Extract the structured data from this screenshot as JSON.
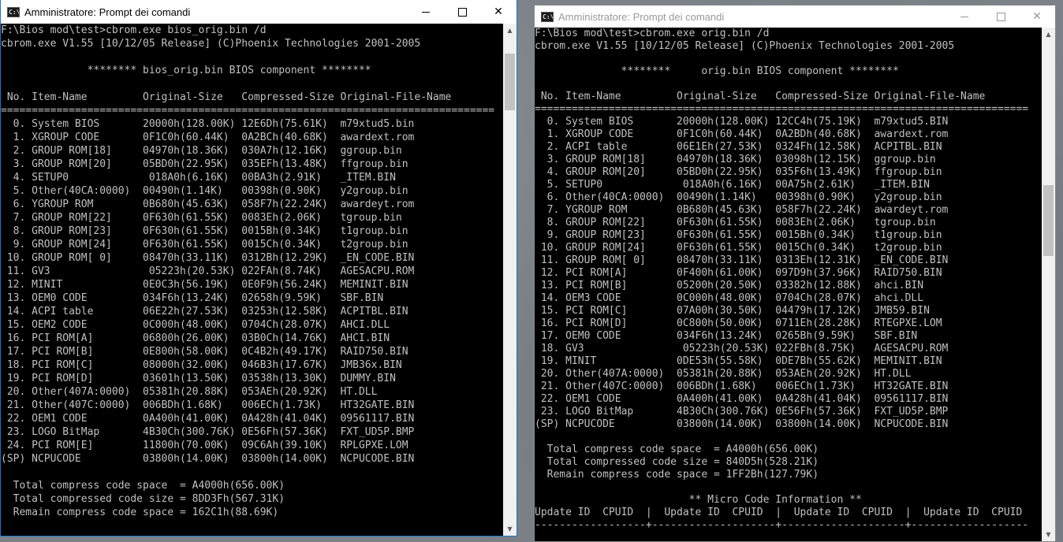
{
  "left_window": {
    "title": "Amministratore: Prompt dei comandi",
    "icon_text": "C:\\",
    "controls": {
      "minimize": "minimize",
      "maximize": "maximize",
      "close": "✕"
    },
    "lines": [
      "F:\\Bios mod\\test>cbrom.exe bios_orig.bin /d",
      "cbrom.exe V1.55 [10/12/05 Release] (C)Phoenix Technologies 2001-2005",
      "",
      "              ******** bios_orig.bin BIOS component ********",
      "",
      " No. Item-Name         Original-Size   Compressed-Size Original-File-Name",
      "================================================================================",
      "  0. System BIOS       20000h(128.00K) 12E6Dh(75.61K)  m79xtud5.bin",
      "  1. XGROUP CODE       0F1C0h(60.44K)  0A2BCh(40.68K)  awardext.rom",
      "  2. GROUP ROM[18]     04970h(18.36K)  030A7h(12.16K)  ggroup.bin",
      "  3. GROUP ROM[20]     05BD0h(22.95K)  035EFh(13.48K)  ffgroup.bin",
      "  4. SETUP0             018A0h(6.16K)  00BA3h(2.91K)   _ITEM.BIN",
      "  5. Other(40CA:0000)  00490h(1.14K)   00398h(0.90K)   y2group.bin",
      "  6. YGROUP ROM        0B680h(45.63K)  058F7h(22.24K)  awardeyt.rom",
      "  7. GROUP ROM[22]     0F630h(61.55K)  0083Eh(2.06K)   tgroup.bin",
      "  8. GROUP ROM[23]     0F630h(61.55K)  0015Bh(0.34K)   t1group.bin",
      "  9. GROUP ROM[24]     0F630h(61.55K)  0015Ch(0.34K)   t2group.bin",
      " 10. GROUP ROM[ 0]     08470h(33.11K)  0312Bh(12.29K)  _EN_CODE.BIN",
      " 11. GV3                05223h(20.53K) 022FAh(8.74K)   AGESACPU.ROM",
      " 12. MINIT             0E0C3h(56.19K)  0E0F9h(56.24K)  MEMINIT.BIN",
      " 13. OEM0 CODE         034F6h(13.24K)  02658h(9.59K)   SBF.BIN",
      " 14. ACPI table        06E22h(27.53K)  03253h(12.58K)  ACPITBL.BIN",
      " 15. OEM2 CODE         0C000h(48.00K)  0704Ch(28.07K)  AHCI.DLL",
      " 16. PCI ROM[A]        06800h(26.00K)  03B0Ch(14.76K)  AHCI.BIN",
      " 17. PCI ROM[B]        0E800h(58.00K)  0C4B2h(49.17K)  RAID750.BIN",
      " 18. PCI ROM[C]        08000h(32.00K)  046B3h(17.67K)  JMB36x.BIN",
      " 19. PCI ROM[D]        03601h(13.50K)  03538h(13.30K)  DUMMY.BIN",
      " 20. Other(407A:0000)  05381h(20.88K)  053AEh(20.92K)  HT.DLL",
      " 21. Other(407C:0000)  006BDh(1.68K)   006ECh(1.73K)   HT32GATE.BIN",
      " 22. OEM1 CODE         0A400h(41.00K)  0A428h(41.04K)  09561117.BIN",
      " 23. LOGO BitMap       4B30Ch(300.76K) 0E56Fh(57.36K)  FXT_UD5P.BMP",
      " 24. PCI ROM[E]        11800h(70.00K)  09C6Ah(39.10K)  RPLGPXE.LOM",
      "(SP) NCPUCODE          03800h(14.00K)  03800h(14.00K)  NCPUCODE.BIN",
      "",
      "  Total compress code space  = A4000h(656.00K)",
      "  Total compressed code size = 8DD3Fh(567.31K)",
      "  Remain compress code space = 162C1h(88.69K)"
    ]
  },
  "right_window": {
    "title": "Amministratore: Prompt dei comandi",
    "icon_text": "C:\\",
    "controls": {
      "minimize": "minimize",
      "maximize": "maximize",
      "close": "✕"
    },
    "lines": [
      "F:\\Bios mod\\test>cbrom.exe orig.bin /d",
      "cbrom.exe V1.55 [10/12/05 Release] (C)Phoenix Technologies 2001-2005",
      "",
      "              ********     orig.bin BIOS component ********",
      "",
      " No. Item-Name         Original-Size   Compressed-Size Original-File-Name",
      "================================================================================",
      "  0. System BIOS       20000h(128.00K) 12CC4h(75.19K)  m79xtud5.BIN",
      "  1. XGROUP CODE       0F1C0h(60.44K)  0A2BDh(40.68K)  awardext.rom",
      "  2. ACPI table        06E1Eh(27.53K)  0324Fh(12.58K)  ACPITBL.BIN",
      "  3. GROUP ROM[18]     04970h(18.36K)  03098h(12.15K)  ggroup.bin",
      "  4. GROUP ROM[20]     05BD0h(22.95K)  035F6h(13.49K)  ffgroup.bin",
      "  5. SETUP0             018A0h(6.16K)  00A75h(2.61K)   _ITEM.BIN",
      "  6. Other(40CA:0000)  00490h(1.14K)   00398h(0.90K)   y2group.bin",
      "  7. YGROUP ROM        0B680h(45.63K)  058F7h(22.24K)  awardeyt.rom",
      "  8. GROUP ROM[22]     0F630h(61.55K)  0083Eh(2.06K)   tgroup.bin",
      "  9. GROUP ROM[23]     0F630h(61.55K)  0015Bh(0.34K)   t1group.bin",
      " 10. GROUP ROM[24]     0F630h(61.55K)  0015Ch(0.34K)   t2group.bin",
      " 11. GROUP ROM[ 0]     08470h(33.11K)  0313Eh(12.31K)  _EN_CODE.BIN",
      " 12. PCI ROM[A]        0F400h(61.00K)  097D9h(37.96K)  RAID750.BIN",
      " 13. PCI ROM[B]        05200h(20.50K)  03382h(12.88K)  ahci.BIN",
      " 14. OEM3 CODE         0C000h(48.00K)  0704Ch(28.07K)  ahci.DLL",
      " 15. PCI ROM[C]        07A00h(30.50K)  04479h(17.12K)  JMB59.BIN",
      " 16. PCI ROM[D]        0C800h(50.00K)  0711Eh(28.28K)  RTEGPXE.LOM",
      " 17. OEM0 CODE         034F6h(13.24K)  0265Bh(9.59K)   SBF.BIN",
      " 18. GV3                05223h(20.53K) 022FBh(8.75K)   AGESACPU.ROM",
      " 19. MINIT             0DE53h(55.58K)  0DE7Bh(55.62K)  MEMINIT.BIN",
      " 20. Other(407A:0000)  05381h(20.88K)  053AEh(20.92K)  HT.DLL",
      " 21. Other(407C:0000)  006BDh(1.68K)   006ECh(1.73K)   HT32GATE.BIN",
      " 22. OEM1 CODE         0A400h(41.00K)  0A428h(41.04K)  09561117.BIN",
      " 23. LOGO BitMap       4B30Ch(300.76K) 0E56Fh(57.36K)  FXT_UD5P.BMP",
      "(SP) NCPUCODE          03800h(14.00K)  03800h(14.00K)  NCPUCODE.BIN",
      "",
      "  Total compress code space  = A4000h(656.00K)",
      "  Total compressed code size = 840D5h(528.21K)",
      "  Remain compress code space = 1FF2Bh(127.79K)",
      "",
      "                         ** Micro Code Information **",
      "Update ID  CPUID  |  Update ID  CPUID  |  Update ID  CPUID  |  Update ID  CPUID",
      "------------------+--------------------+--------------------+-------------------"
    ]
  }
}
